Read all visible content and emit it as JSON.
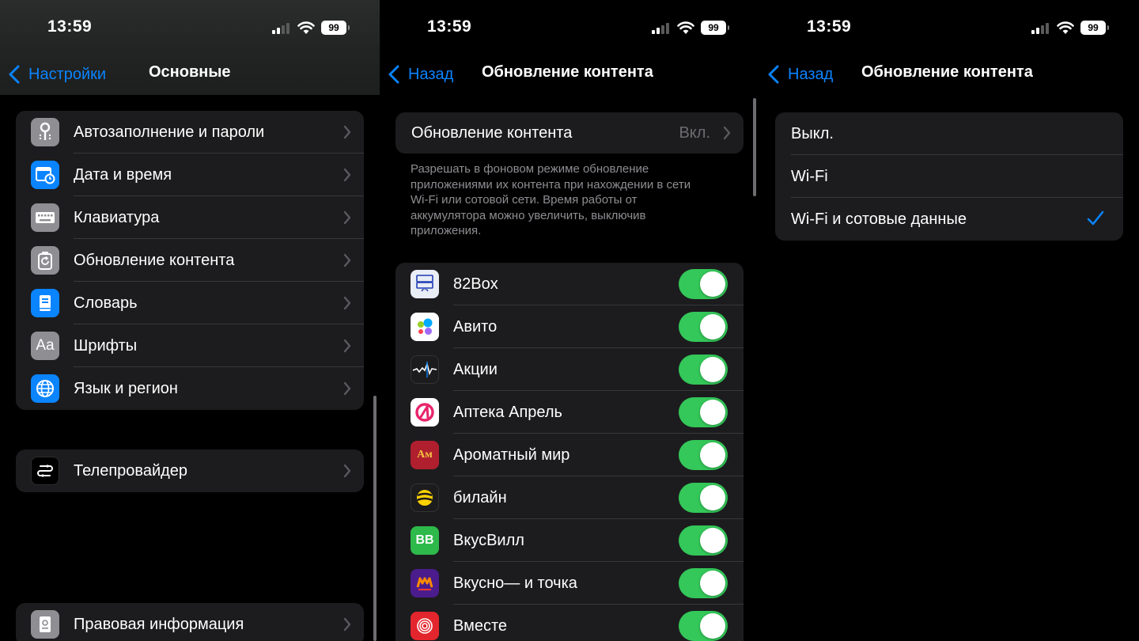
{
  "status": {
    "time": "13:59",
    "battery": "99"
  },
  "colors": {
    "accent": "#0a84ff",
    "toggle_on": "#34c759",
    "group_bg": "#1c1c1e",
    "footer_text": "#8e8e93"
  },
  "panel1": {
    "back_label": "Настройки",
    "title": "Основные",
    "group1": [
      {
        "label": "Автозаполнение и пароли",
        "icon": "key-icon"
      },
      {
        "label": "Дата и время",
        "icon": "calendar-clock-icon"
      },
      {
        "label": "Клавиатура",
        "icon": "keyboard-icon"
      },
      {
        "label": "Обновление контента",
        "icon": "refresh-icon"
      },
      {
        "label": "Словарь",
        "icon": "book-icon"
      },
      {
        "label": "Шрифты",
        "icon": "font-icon",
        "icon_text": "Aa"
      },
      {
        "label": "Язык и регион",
        "icon": "globe-icon"
      }
    ],
    "group2": [
      {
        "label": "Телепровайдер",
        "icon": "tv-provider-icon"
      }
    ],
    "group3": [
      {
        "label": "Правовая информация",
        "icon": "legal-icon"
      }
    ]
  },
  "panel2": {
    "back_label": "Назад",
    "title": "Обновление контента",
    "setting": {
      "label": "Обновление контента",
      "value": "Вкл."
    },
    "footer": "Разрешать в фоновом режиме обновление приложениями их контента при нахождении в сети Wi-Fi или сотовой сети. Время работы от аккумулятора можно увеличить, выключив приложения.",
    "apps": [
      {
        "label": "82Box",
        "icon": "82box-icon",
        "enabled": true
      },
      {
        "label": "Авито",
        "icon": "avito-icon",
        "enabled": true
      },
      {
        "label": "Акции",
        "icon": "stocks-icon",
        "enabled": true
      },
      {
        "label": "Аптека Апрель",
        "icon": "apteka-aprel-icon",
        "enabled": true
      },
      {
        "label": "Ароматный мир",
        "icon": "aromatny-mir-icon",
        "icon_text": "Ам",
        "enabled": true
      },
      {
        "label": "билайн",
        "icon": "beeline-icon",
        "enabled": true
      },
      {
        "label": "ВкусВилл",
        "icon": "vkusvill-icon",
        "icon_text": "BB",
        "enabled": true
      },
      {
        "label": "Вкусно— и точка",
        "icon": "vkusno-i-tochka-icon",
        "enabled": true
      },
      {
        "label": "Вместе",
        "icon": "vmeste-icon",
        "enabled": true
      }
    ]
  },
  "panel3": {
    "back_label": "Назад",
    "title": "Обновление контента",
    "options": [
      {
        "label": "Выкл.",
        "selected": false
      },
      {
        "label": "Wi-Fi",
        "selected": false
      },
      {
        "label": "Wi-Fi и сотовые данные",
        "selected": true
      }
    ]
  }
}
